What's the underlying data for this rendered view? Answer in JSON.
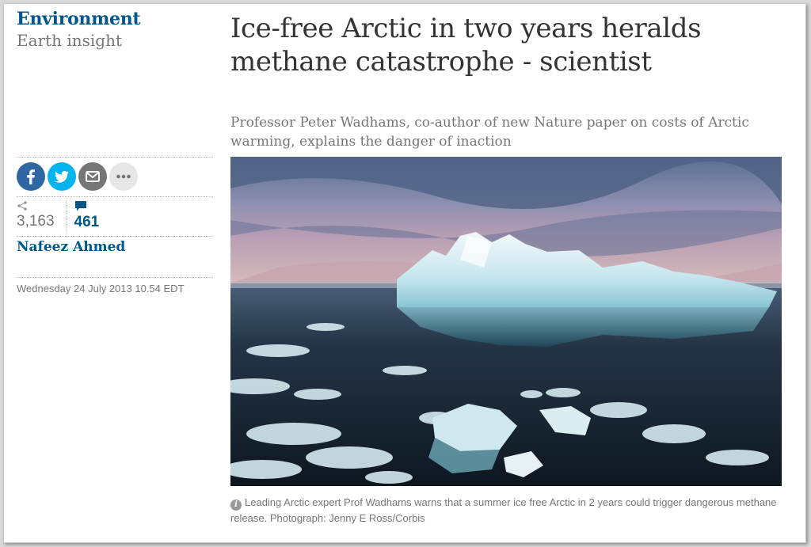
{
  "section": {
    "name": "Environment",
    "series": "Earth insight"
  },
  "article": {
    "headline": "Ice-free Arctic in two years heralds methane catastrophe - scientist",
    "standfirst": "Professor Peter Wadhams, co-author of new Nature paper on costs of Arctic warming, explains the danger of inaction",
    "byline": "Nafeez Ahmed",
    "dateline": "Wednesday 24 July 2013 10.54 EDT"
  },
  "share": {
    "buttons": [
      {
        "icon": "facebook-icon",
        "color": "#3067a3"
      },
      {
        "icon": "twitter-icon",
        "color": "#03b3ee"
      },
      {
        "icon": "email-icon",
        "color": "#767676"
      },
      {
        "icon": "more-icon",
        "color": "#e6e6e6"
      }
    ],
    "share_count": "3,163",
    "comment_count": "461"
  },
  "image": {
    "caption": "Leading Arctic expert Prof Wadhams warns that a summer ice free Arctic in 2 years could trigger dangerous methane release. Photograph: Jenny E Ross/Corbis"
  },
  "colors": {
    "brand_blue": "#005689",
    "muted_text": "#767676",
    "headline_text": "#333333"
  }
}
